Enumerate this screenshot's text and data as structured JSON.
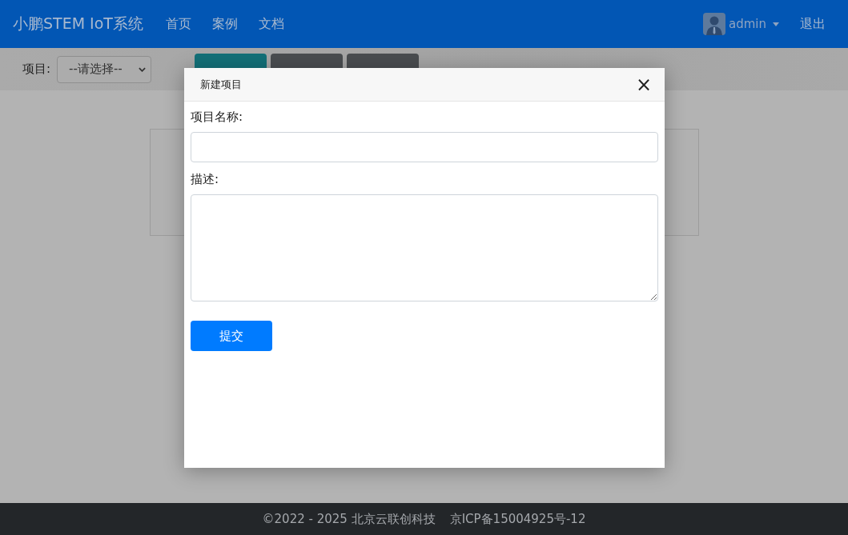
{
  "navbar": {
    "brand": "小鹏STEM IoT系统",
    "links": [
      {
        "label": "首页"
      },
      {
        "label": "案例"
      },
      {
        "label": "文档"
      }
    ],
    "user": "admin",
    "logout": "退出"
  },
  "toolbar": {
    "project_label": "项目:",
    "project_select": "--请选择--",
    "buttons": [
      {
        "kind": "teal"
      },
      {
        "kind": "gray"
      },
      {
        "kind": "gray"
      }
    ]
  },
  "modal": {
    "title": "新建项目",
    "close": "×",
    "fields": [
      {
        "label": "项目名称:",
        "kind": "input"
      },
      {
        "label": "描述:",
        "kind": "textarea"
      }
    ],
    "submit": "提交"
  },
  "footer": {
    "copyright": "©2022 - 2025 北京云联创科技",
    "icp": "京ICP备15004925号-12"
  }
}
